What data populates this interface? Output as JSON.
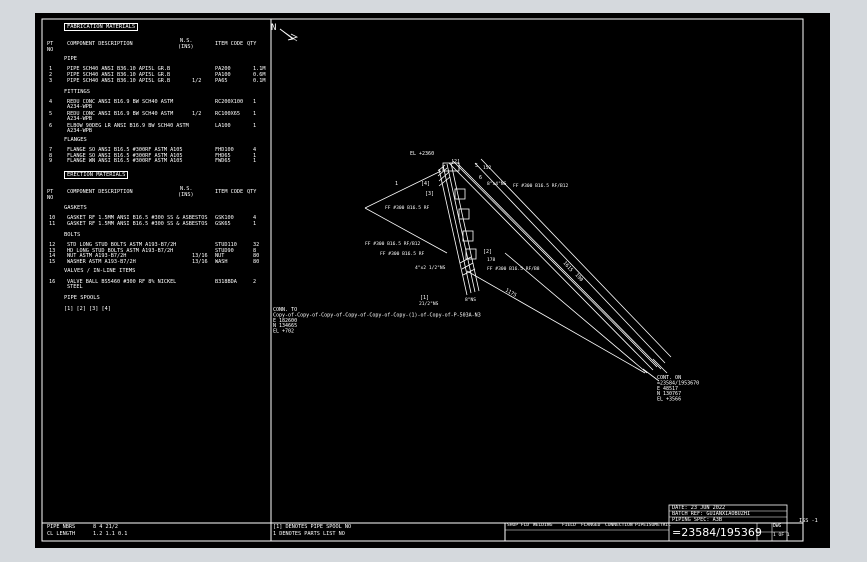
{
  "materials": {
    "fabrication_title": "FABRICATION MATERIALS",
    "col_pt": "PT",
    "col_no": "NO",
    "col_component": "COMPONENT DESCRIPTION",
    "col_ns": "N.S.",
    "col_ins": "(INS)",
    "col_item_code": "ITEM CODE",
    "col_qty": "QTY",
    "pipe_title": "PIPE",
    "pipe_rows": [
      {
        "pt": "1",
        "desc": "PIPE SCH40 ANSI B36.10 API5L GR.B",
        "ns": "",
        "code": "PA200",
        "qty": "1.1M"
      },
      {
        "pt": "2",
        "desc": "PIPE SCH40 ANSI B36.10 API5L GR.B",
        "ns": "",
        "code": "PA100",
        "qty": "0.6M"
      },
      {
        "pt": "3",
        "desc": "PIPE SCH40 ANSI B36.10 API5L GR.B",
        "ns": "1/2",
        "code": "PA65",
        "qty": "0.1M"
      }
    ],
    "fittings_title": "FITTINGS",
    "fitting_rows": [
      {
        "pt": "4",
        "desc": "REDU CONC ANSI B16.9 BW SCH40 ASTM",
        "desc2": "A234-WPB",
        "ns": "",
        "code": "RC200X100",
        "qty": "1"
      },
      {
        "pt": "5",
        "desc": "REDU CONC ANSI B16.9 BW SCH40 ASTM",
        "desc2": "A234-WPB",
        "ns": "1/2",
        "code": "RC100X65",
        "qty": "1"
      },
      {
        "pt": "6",
        "desc": "ELBOW 90DEG LR ANSI B16.9 BW SCH40 ASTM",
        "desc2": "A234-WPB",
        "ns": "",
        "code": "LA100",
        "qty": "1"
      }
    ],
    "flanges_title": "FLANGES",
    "flange_rows": [
      {
        "pt": "7",
        "desc": "FLANGE SO ANSI B16.5 #300RF ASTM A105",
        "ns": "",
        "code": "FHD100",
        "qty": "4"
      },
      {
        "pt": "8",
        "desc": "FLANGE SO ANSI B16.5 #300RF ASTM A105",
        "ns": "",
        "code": "FHD65",
        "qty": "1"
      },
      {
        "pt": "9",
        "desc": "FLANGE WN ANSI B16.5 #300RF ASTM A105",
        "ns": "",
        "code": "FWD65",
        "qty": "1"
      }
    ],
    "erection_title": "ERECTION MATERIALS",
    "gaskets_title": "GASKETS",
    "gasket_rows": [
      {
        "pt": "10",
        "desc": "GASKET RF 1.5MM ANSI B16.5 #300 SS & ASBESTOS",
        "ns": "",
        "code": "GSK100",
        "qty": "4"
      },
      {
        "pt": "11",
        "desc": "GASKET RF 1.5MM ANSI B16.5 #300 SS & ASBESTOS",
        "ns": "",
        "code": "GSK65",
        "qty": "1"
      }
    ],
    "bolts_title": "BOLTS",
    "bolt_rows": [
      {
        "pt": "12",
        "desc": "STD LONG STUD BOLTS ASTM A193-B7/2H",
        "ns": "",
        "code": "STUD110",
        "qty": "32"
      },
      {
        "pt": "13",
        "desc": "HD LONG STUD BOLTS ASTM A193-B7/2H",
        "ns": "",
        "code": "STUD90",
        "qty": "8"
      },
      {
        "pt": "14",
        "desc": "NUT ASTM A193-B7/2H",
        "ns": "13/16",
        "code": "NUT",
        "qty": "80"
      },
      {
        "pt": "15",
        "desc": "WASHER ASTM A193-B7/2H",
        "ns": "13/16",
        "code": "WASH",
        "qty": "80"
      }
    ],
    "valves_title": "VALVES / IN-LINE ITEMS",
    "valve_rows": [
      {
        "pt": "16",
        "desc": "VALVE BALL BS5460 #300 RF 8% NICKEL",
        "desc2": "STEEL",
        "ns": "",
        "code": "B318BDA",
        "qty": "2"
      }
    ],
    "spools_title": "PIPE SPOOLS",
    "spools": "[1] [2] [3] [4]",
    "bottom_pipe_nbrs_label": "PIPE NBRS",
    "bottom_pipe_nbrs_vals": "8   4   21/2",
    "bottom_cl_label": "CL LENGTH",
    "bottom_cl_vals": "1.2  1.1   0.1"
  },
  "notes": {
    "line1": "[1] DENOTES PIPE SPOOL NO",
    "line2": "1  DENOTES PARTS LIST NO"
  },
  "title_block": {
    "date": "DATE: 23 JUN 2022",
    "batch": "BATCH REF: GUIANXIAOBUZHI",
    "spec": "PIPING SPEC: A3B",
    "cell1": "SHOP FLD",
    "cell2": "WELDING",
    "cell3": "FIELD",
    "cell4": "FLANGED",
    "cell5": "CONNECTION",
    "cell6": "PIPE",
    "cell7": "ISOMETRIC",
    "drawing_no": "=23584/195369",
    "dwg_label": "DWG",
    "sheet": "1 OF 1",
    "iss": "ISS  -1"
  },
  "drawing": {
    "north": "N",
    "el_top": "EL +2360",
    "labels": {
      "ref_a": "[2]",
      "ref_b": "[4]",
      "ref_c": "[1]",
      "ref_d": "[3]",
      "ref_e": "[2]",
      "part_5": "5",
      "part_6": "6",
      "size_a": "8\"x4\"NS",
      "flange_a": "FF #300 B16.5 RF/B12",
      "flange_b": "FF #300 B16.5 RF",
      "flange_c": "FF #300 B16.5 RF/B12",
      "flange_d": "FF #300 B16.5 RF",
      "flange_e": "FF #300 B16.5 RF/B8",
      "size_b": "4\"x2 1/2\"NS",
      "size_c": "8\"NS",
      "size_d": "21/2\"NS",
      "dim_152": "152",
      "dim_178": "178",
      "dim_1": "1",
      "dim_1615": "1615",
      "dim_1175": "1175",
      "dim_190": "190"
    },
    "conn_to": [
      "CONN. TO",
      "Copy-of-Copy-of-Copy-of-Copy-of-Copy-of-Copy-(1)-of-Copy-of-P-503A-N3",
      "E 182600",
      "N 134665",
      "EL +702"
    ],
    "cont_on": [
      "CONT. ON",
      "=23584/1953670",
      "E 48517",
      "N 130767",
      "EL +3566"
    ]
  }
}
